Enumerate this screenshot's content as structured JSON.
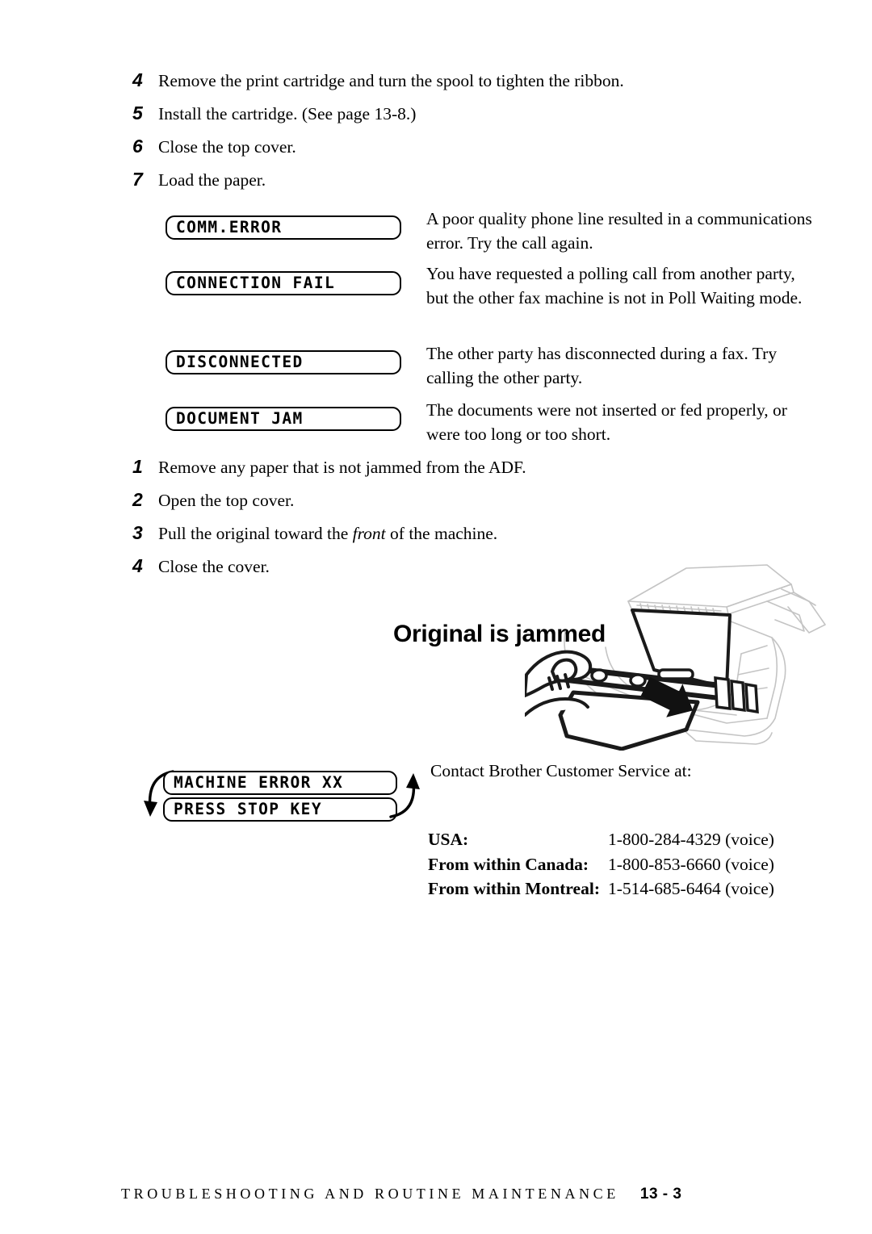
{
  "steps_top": [
    {
      "num": "4",
      "text": "Remove the print cartridge and turn the spool to tighten the ribbon."
    },
    {
      "num": "5",
      "text": "Install the cartridge. (See page 13-8.)"
    },
    {
      "num": "6",
      "text": "Close the top cover."
    },
    {
      "num": "7",
      "text": "Load the paper."
    }
  ],
  "error_table": [
    {
      "lcd": "COMM.ERROR",
      "description": "A poor quality phone line resulted in a communications error. Try the call again."
    },
    {
      "lcd": "CONNECTION FAIL",
      "description": "You have requested a polling call from another party, but the other fax machine is not in Poll Waiting mode."
    },
    {
      "lcd": "DISCONNECTED",
      "description": "The other party has disconnected during a fax. Try calling the other party."
    },
    {
      "lcd": "DOCUMENT JAM",
      "description": "The documents were not inserted or fed properly, or were too long or too short."
    }
  ],
  "steps_jam": [
    {
      "num": "1",
      "text": "Remove any paper that is not jammed from the ADF."
    },
    {
      "num": "2",
      "text": "Open the top cover."
    },
    {
      "num": "3",
      "text_before": "Pull the original toward the ",
      "text_italic": "front",
      "text_after": " of the machine."
    },
    {
      "num": "4",
      "text": "Close the cover."
    }
  ],
  "jam_heading": "Original is jammed",
  "machine_error": {
    "line1": "MACHINE ERROR XX",
    "line2": "PRESS STOP KEY"
  },
  "contact": {
    "intro": "Contact Brother Customer Service at:",
    "rows": [
      {
        "label": "USA:",
        "value": "1-800-284-4329 (voice)"
      },
      {
        "label": "From within Canada:",
        "value": "1-800-853-6660 (voice)"
      },
      {
        "label": "From within Montreal:",
        "value": "1-514-685-6464 (voice)"
      }
    ]
  },
  "footer": {
    "title": "TROUBLESHOOTING AND ROUTINE MAINTENANCE",
    "page": "13 - 3"
  },
  "colors": {
    "ink": "#000000",
    "paper": "#ffffff",
    "illustration_light": "#c9c9c9",
    "illustration_dark": "#1a1a1a"
  }
}
